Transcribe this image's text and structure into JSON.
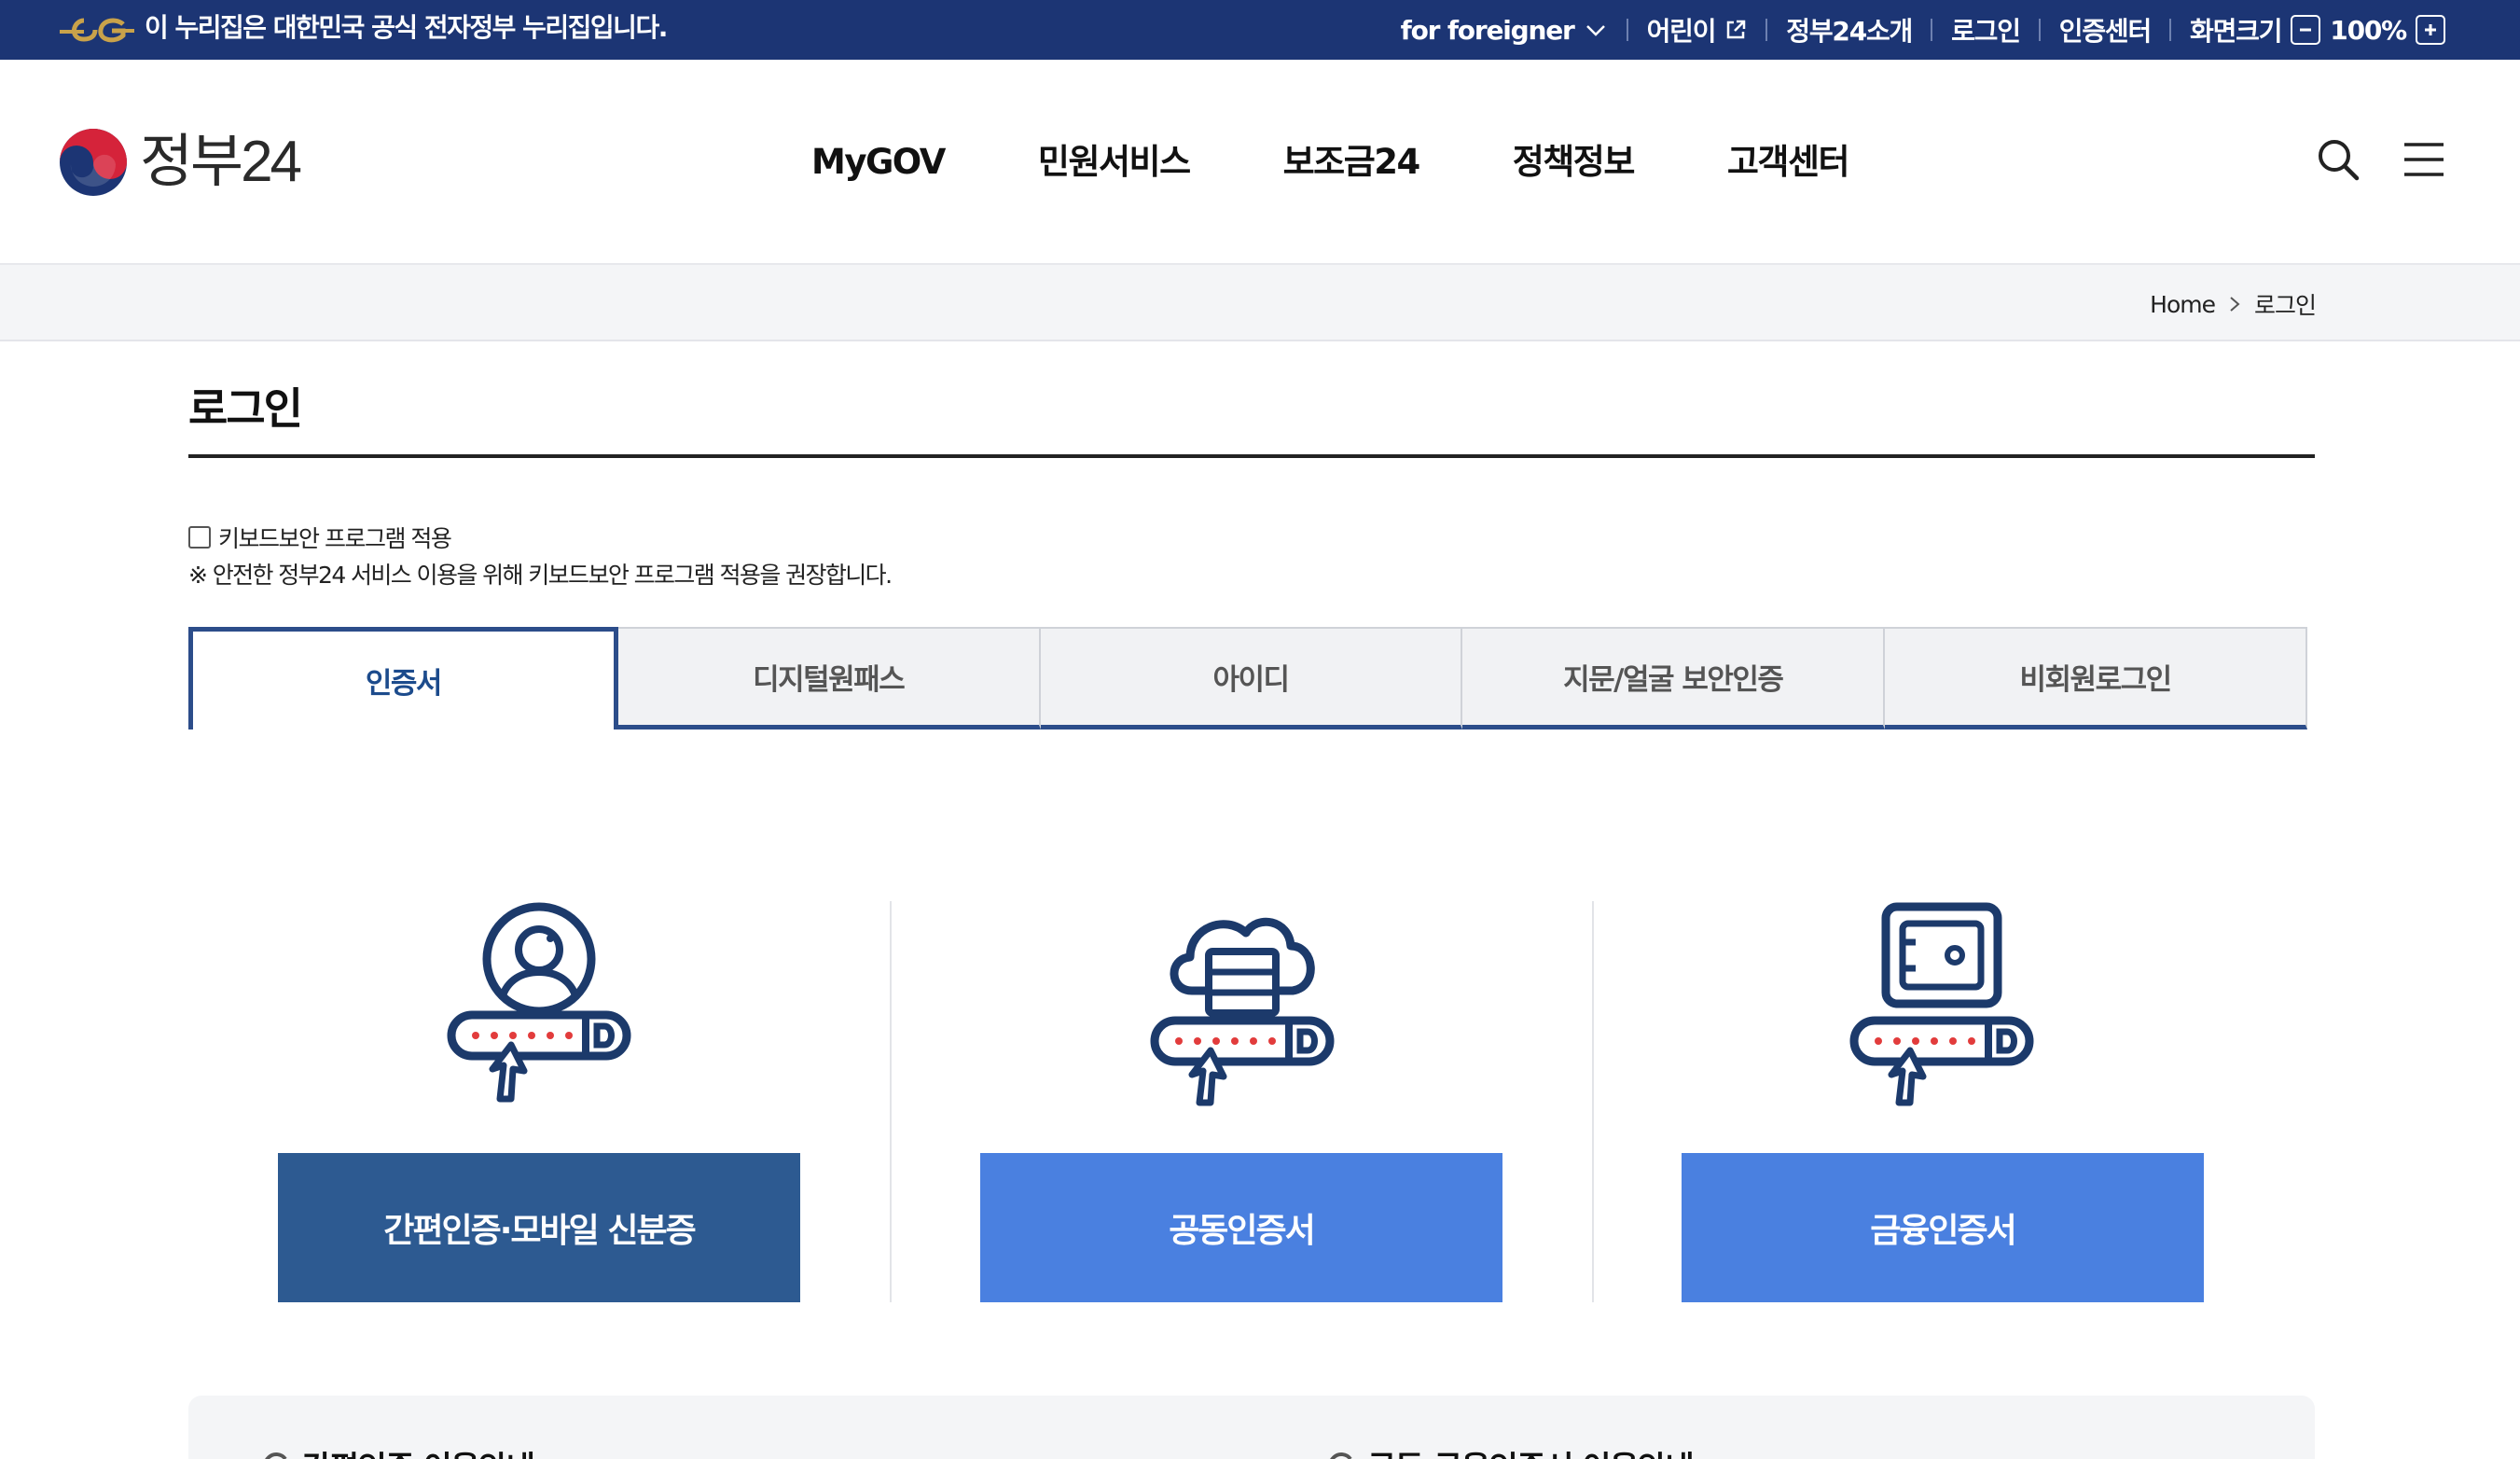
{
  "topbar": {
    "notice": "이 누리집은 대한민국 공식 전자정부 누리집입니다.",
    "foreigner": "for foreigner",
    "kids": "어린이",
    "about": "정부24소개",
    "login": "로그인",
    "cert_center": "인증센터",
    "screen_size": "화면크기",
    "zoom": "100%"
  },
  "header": {
    "logo_text": "정부24",
    "nav": [
      "MyGOV",
      "민원서비스",
      "보조금24",
      "정책정보",
      "고객센터"
    ]
  },
  "breadcrumb": {
    "home": "Home",
    "current": "로그인"
  },
  "page": {
    "title": "로그인",
    "keyboard_security_label": "키보드보안 프로그램 적용",
    "keyboard_security_note": "※ 안전한 정부24 서비스 이용을 위해 키보드보안 프로그램 적용을 권장합니다."
  },
  "tabs": [
    "인증서",
    "디지털원패스",
    "아이디",
    "지문/얼굴 보안인증",
    "비회원로그인"
  ],
  "active_tab": "인증서",
  "cards": [
    {
      "label": "간편인증·모바일 신분증",
      "icon": "user-login-icon",
      "color": "#2d5a91"
    },
    {
      "label": "공동인증서",
      "icon": "cloud-server-login-icon",
      "color": "#4a80e0"
    },
    {
      "label": "금융인증서",
      "icon": "safe-login-icon",
      "color": "#4a80e0"
    }
  ],
  "info": {
    "left": "간편인증 이용안내",
    "right": "공동·금융인증서 이용안내"
  },
  "colors": {
    "topbar": "#1c3574",
    "primary_dark": "#2d5a91",
    "primary": "#4a80e0",
    "icon_navy": "#1c3a6b",
    "accent_red": "#e23c3c"
  }
}
